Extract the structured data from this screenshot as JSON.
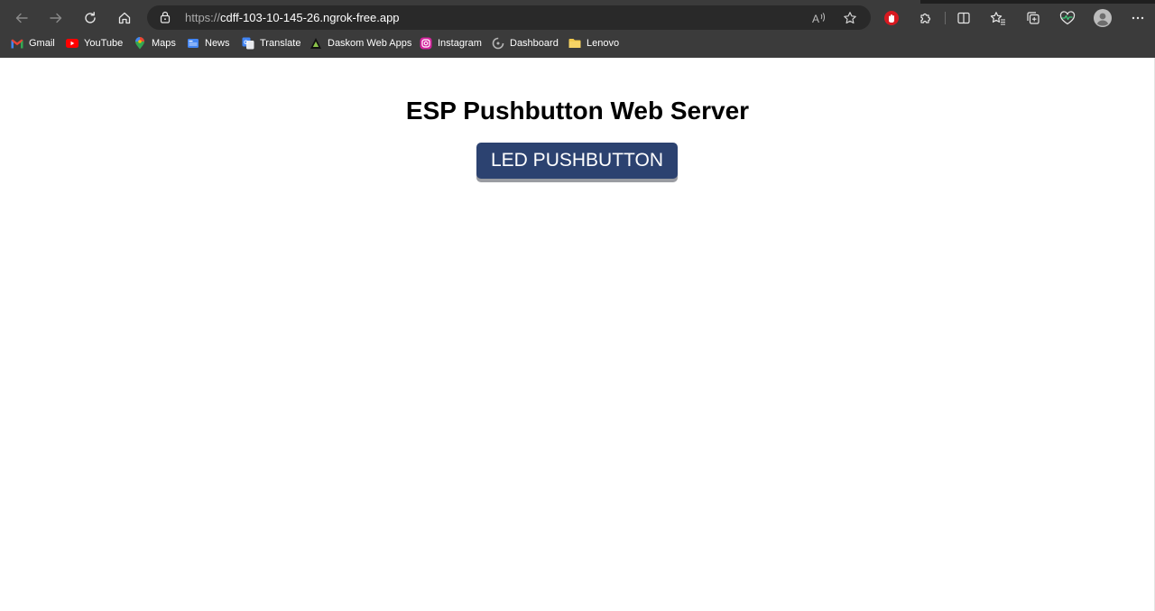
{
  "browser": {
    "address_bar": {
      "scheme": "https://",
      "host": "cdff-103-10-145-26.ngrok-free.app"
    },
    "toolbar_icons": [
      "back-icon",
      "forward-icon",
      "refresh-icon",
      "home-icon",
      "lock-icon",
      "read-aloud-icon",
      "favorite-star-icon",
      "extension-red-icon",
      "extensions-puzzle-icon",
      "split-screen-icon",
      "favorites-icon",
      "collections-icon",
      "browser-essentials-icon",
      "profile-avatar-icon",
      "more-menu-icon"
    ],
    "bookmarks": [
      {
        "label": "Gmail",
        "icon": "gmail-icon"
      },
      {
        "label": "YouTube",
        "icon": "youtube-icon"
      },
      {
        "label": "Maps",
        "icon": "maps-icon"
      },
      {
        "label": "News",
        "icon": "news-icon"
      },
      {
        "label": "Translate",
        "icon": "translate-icon"
      },
      {
        "label": "Daskom Web Apps",
        "icon": "daskom-icon"
      },
      {
        "label": "Instagram",
        "icon": "instagram-icon"
      },
      {
        "label": "Dashboard",
        "icon": "dashboard-icon"
      },
      {
        "label": "Lenovo",
        "icon": "folder-icon"
      }
    ],
    "colors": {
      "chrome": "#3b3b3b",
      "address_bar": "#292929"
    }
  },
  "page": {
    "heading": "ESP Pushbutton Web Server",
    "button_label": "LED PUSHBUTTON",
    "colors": {
      "button_bg": "#2c4270",
      "button_shadow": "#9a9ca2"
    }
  }
}
